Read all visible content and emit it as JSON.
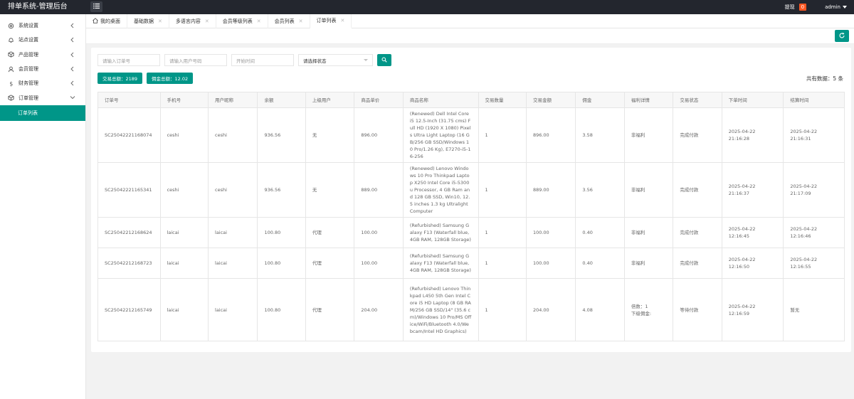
{
  "header": {
    "logo": "排单系统-管理后台",
    "withdraw_label": "提现",
    "withdraw_count": "0",
    "user": "admin"
  },
  "sidebar": {
    "items": [
      {
        "label": "系统设置",
        "icon": "gear-icon"
      },
      {
        "label": "站点设置",
        "icon": "bell-icon"
      },
      {
        "label": "产品管理",
        "icon": "cube-icon"
      },
      {
        "label": "会员管理",
        "icon": "user-icon"
      },
      {
        "label": "财务管理",
        "icon": "dollar-icon"
      },
      {
        "label": "订单管理",
        "icon": "cube-icon"
      }
    ],
    "sub_active": "订单列表"
  },
  "tabs": [
    {
      "label": "我的桌面",
      "closable": false
    },
    {
      "label": "基础数据",
      "closable": true
    },
    {
      "label": "多语言内容",
      "closable": true
    },
    {
      "label": "会员等级列表",
      "closable": true
    },
    {
      "label": "会员列表",
      "closable": true
    },
    {
      "label": "订单列表",
      "closable": true
    }
  ],
  "filters": {
    "order_no_placeholder": "请输入订单号",
    "user_no_placeholder": "请输入用户号码",
    "start_time_placeholder": "开始时间",
    "status_select": "请选择状态"
  },
  "totals": {
    "trade_total": "交易总额：2189",
    "commission_total": "佣金总额：12.02",
    "count_text": "共有数据：5 条"
  },
  "table": {
    "headers": [
      "订单号",
      "手机号",
      "用户昵称",
      "余额",
      "上级用户",
      "商品单价",
      "商品名称",
      "交易数量",
      "交易金额",
      "佣金",
      "福利详情",
      "交易状态",
      "下单时间",
      "结算时间"
    ],
    "rows": [
      [
        "SC25042221168074",
        "ceshi",
        "ceshi",
        "936.56",
        "无",
        "896.00",
        "(Renewed) Dell Intel Core i5 12.5-Inch (31.75 cms) Full HD (1920 X 1080) Pixels Ultra Light Laptop (16 GB/256 GB SSD/Windows 10 Pro/1.26 Kg), E7270-i5-16-256",
        "1",
        "896.00",
        "3.58",
        "非福利",
        "完成付款",
        "2025-04-22 21:16:28",
        "2025-04-22 21:16:31"
      ],
      [
        "SC25042221165341",
        "ceshi",
        "ceshi",
        "936.56",
        "无",
        "889.00",
        "(Renewed) Lenovo Windows 10 Pro Thinkpad Laptop X250 Intel Core i5-5300u Processor, 4 GB Ram and 128 GB SSD, Win10, 12.5 inches 1.3 kg Ultralight Computer",
        "1",
        "889.00",
        "3.56",
        "非福利",
        "完成付款",
        "2025-04-22 21:16:37",
        "2025-04-22 21:17:09"
      ],
      [
        "SC25042212168624",
        "laicai",
        "laicai",
        "100.80",
        "代理",
        "100.00",
        "(Refurbished) Samsung Galaxy F13 (Waterfall blue,4GB RAM, 128GB Storage)",
        "1",
        "100.00",
        "0.40",
        "非福利",
        "完成付款",
        "2025-04-22 12:16:45",
        "2025-04-22 12:16:46"
      ],
      [
        "SC25042212168723",
        "laicai",
        "laicai",
        "100.80",
        "代理",
        "100.00",
        "(Refurbished) Samsung Galaxy F13 (Waterfall blue,4GB RAM, 128GB Storage)",
        "1",
        "100.00",
        "0.40",
        "非福利",
        "完成付款",
        "2025-04-22 12:16:50",
        "2025-04-22 12:16:55"
      ],
      [
        "SC25042212165749",
        "laicai",
        "laicai",
        "100.80",
        "代理",
        "204.00",
        "(Refurbished) Lenovo Thinkpad L450 5th Gen Intel Core i5 HD Laptop (8 GB RAM/256 GB SSD/14\" (35.6 cm)/Windows 10 Pro/MS Office/WiFi/Bluetooth 4.0/Webcam/Intel HD Graphics)",
        "1",
        "204.00",
        "4.08",
        "倍数：1\n下级佣金:",
        "等待付款",
        "2025-04-22 12:16:59",
        "暂无"
      ]
    ]
  },
  "colors": {
    "accent": "#009688",
    "topbar": "#23262e",
    "badge": "#ff5722"
  }
}
